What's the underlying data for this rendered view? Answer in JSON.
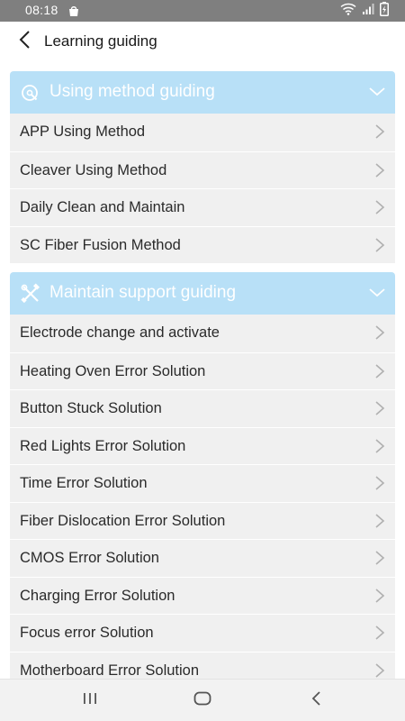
{
  "status_bar": {
    "time": "08:18"
  },
  "app_bar": {
    "title": "Learning guiding"
  },
  "sections": [
    {
      "title": "Using method guiding",
      "icon": "guide-icon",
      "expanded": true,
      "items": [
        {
          "label": "APP Using Method"
        },
        {
          "label": "Cleaver Using Method"
        },
        {
          "label": "Daily Clean and Maintain"
        },
        {
          "label": "SC Fiber Fusion Method"
        }
      ]
    },
    {
      "title": "Maintain support guiding",
      "icon": "tools-icon",
      "expanded": true,
      "items": [
        {
          "label": "Electrode change and activate"
        },
        {
          "label": "Heating Oven Error Solution"
        },
        {
          "label": "Button Stuck Solution"
        },
        {
          "label": "Red Lights Error Solution"
        },
        {
          "label": "Time Error Solution"
        },
        {
          "label": "Fiber Dislocation Error Solution"
        },
        {
          "label": "CMOS Error Solution"
        },
        {
          "label": "Charging Error Solution"
        },
        {
          "label": "Focus error Solution"
        },
        {
          "label": "Motherboard Error Solution"
        }
      ]
    }
  ],
  "colors": {
    "section_header_bg": "#b8e0f7",
    "item_bg": "#f0f0f0",
    "status_bar_bg": "#7f7f7f"
  }
}
